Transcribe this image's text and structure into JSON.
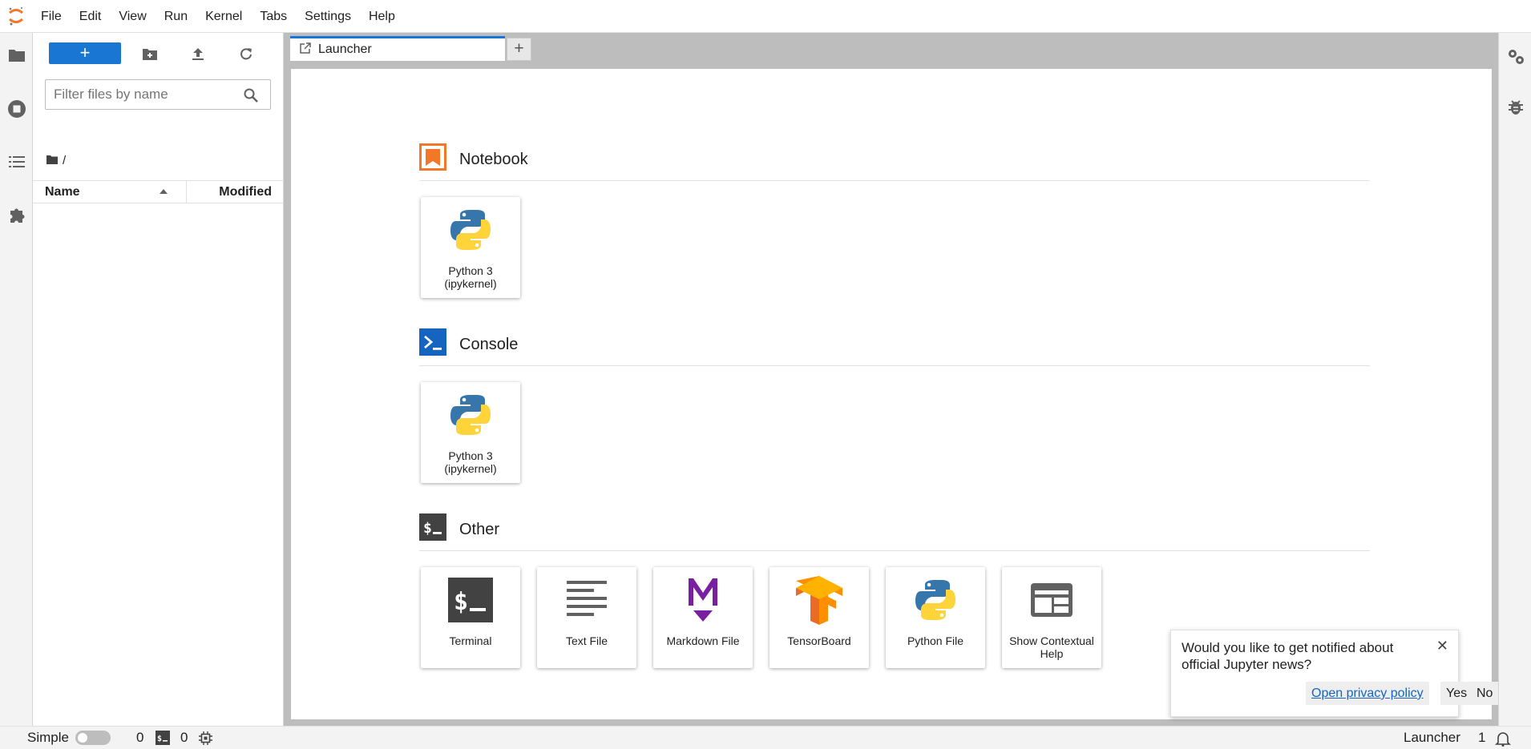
{
  "menubar": {
    "items": [
      "File",
      "Edit",
      "View",
      "Run",
      "Kernel",
      "Tabs",
      "Settings",
      "Help"
    ]
  },
  "left_rail": {
    "icons": [
      "folder-icon",
      "running-icon",
      "table-of-contents-icon",
      "extension-icon"
    ]
  },
  "file_browser": {
    "new_button_label": "+",
    "search_placeholder": "Filter files by name",
    "breadcrumb_path": "/",
    "columns": {
      "name": "Name",
      "modified": "Modified"
    }
  },
  "tabs": [
    {
      "label": "Launcher",
      "icon": "launcher-icon"
    }
  ],
  "tab_add_label": "+",
  "launcher": {
    "sections": [
      {
        "title": "Notebook",
        "icon": "notebook-icon",
        "items": [
          {
            "label": "Python 3 (ipykernel)",
            "icon": "python-icon"
          }
        ]
      },
      {
        "title": "Console",
        "icon": "console-icon",
        "items": [
          {
            "label": "Python 3 (ipykernel)",
            "icon": "python-icon"
          }
        ]
      },
      {
        "title": "Other",
        "icon": "other-icon",
        "items": [
          {
            "label": "Terminal",
            "icon": "terminal-icon"
          },
          {
            "label": "Text File",
            "icon": "text-file-icon"
          },
          {
            "label": "Markdown File",
            "icon": "markdown-icon"
          },
          {
            "label": "TensorBoard",
            "icon": "tensorboard-icon"
          },
          {
            "label": "Python File",
            "icon": "python-icon"
          },
          {
            "label": "Show Contextual Help",
            "icon": "contextual-help-icon"
          }
        ]
      }
    ]
  },
  "right_rail": {
    "icons": [
      "property-inspector-icon",
      "debugger-icon"
    ]
  },
  "statusbar": {
    "simple_label": "Simple",
    "kernel_count": "0",
    "terminal_count": "0",
    "current_activity": "Launcher",
    "notification_count": "1"
  },
  "notification": {
    "message": "Would you like to get notified about official Jupyter news?",
    "privacy_link": "Open privacy policy",
    "yes_label": "Yes",
    "no_label": "No"
  },
  "colors": {
    "accent": "#1976d2",
    "jupyter_orange": "#f37726",
    "python_blue": "#3776ab",
    "python_yellow": "#ffd43b"
  }
}
